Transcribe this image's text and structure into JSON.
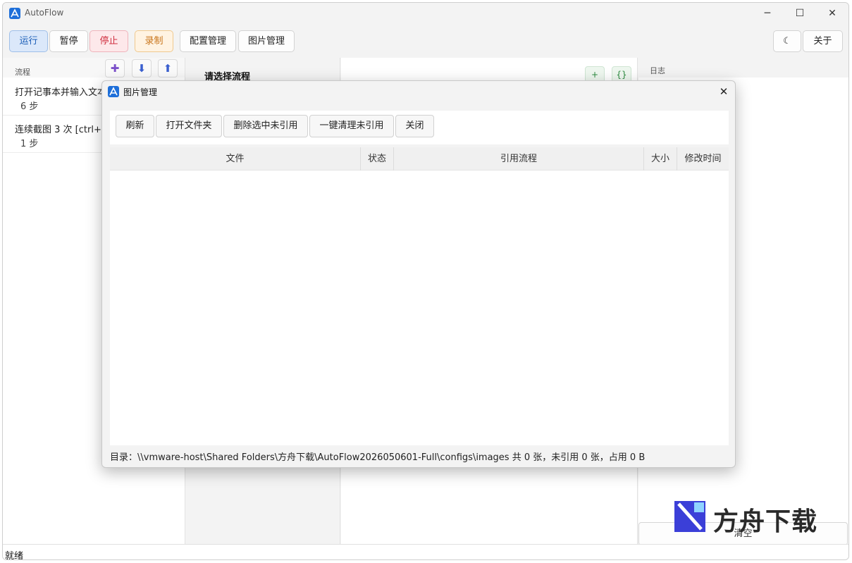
{
  "app": {
    "title": "AutoFlow"
  },
  "window_controls": {
    "minimize": "─",
    "maximize": "☐",
    "close": "✕"
  },
  "toolbar": {
    "run": "运行",
    "pause": "暂停",
    "stop": "停止",
    "record": "录制",
    "config": "配置管理",
    "images": "图片管理",
    "theme_icon": "☾",
    "about": "关于"
  },
  "flows_panel": {
    "header": "流程",
    "items": [
      {
        "name": "打开记事本并输入文本",
        "steps": "6 步"
      },
      {
        "name": "连续截图 3 次 [ctrl+s",
        "steps": "1 步"
      }
    ]
  },
  "editor": {
    "title": "请选择流程",
    "add_label": "+",
    "json_label": "{}"
  },
  "log_panel": {
    "header": "日志",
    "clear": "清空"
  },
  "status": {
    "text": "就绪"
  },
  "watermark": {
    "text": "方舟下载"
  },
  "dialog": {
    "title": "图片管理",
    "close": "✕",
    "buttons": {
      "refresh": "刷新",
      "open_folder": "打开文件夹",
      "delete_selected": "删除选中未引用",
      "clean_all": "一键清理未引用",
      "close": "关闭"
    },
    "columns": [
      "文件",
      "状态",
      "引用流程",
      "大小",
      "修改时间"
    ],
    "footer": "目录：\\\\vmware-host\\Shared Folders\\方舟下载\\AutoFlow2026050601-Full\\configs\\images    共 0 张，未引用 0 张，占用 0 B"
  },
  "colors": {
    "accent": "#1e6fd9",
    "run_bg": "#dbe8fa",
    "stop_text": "#d02f40",
    "record_text": "#c9751a",
    "green": "#2b8a3e"
  }
}
